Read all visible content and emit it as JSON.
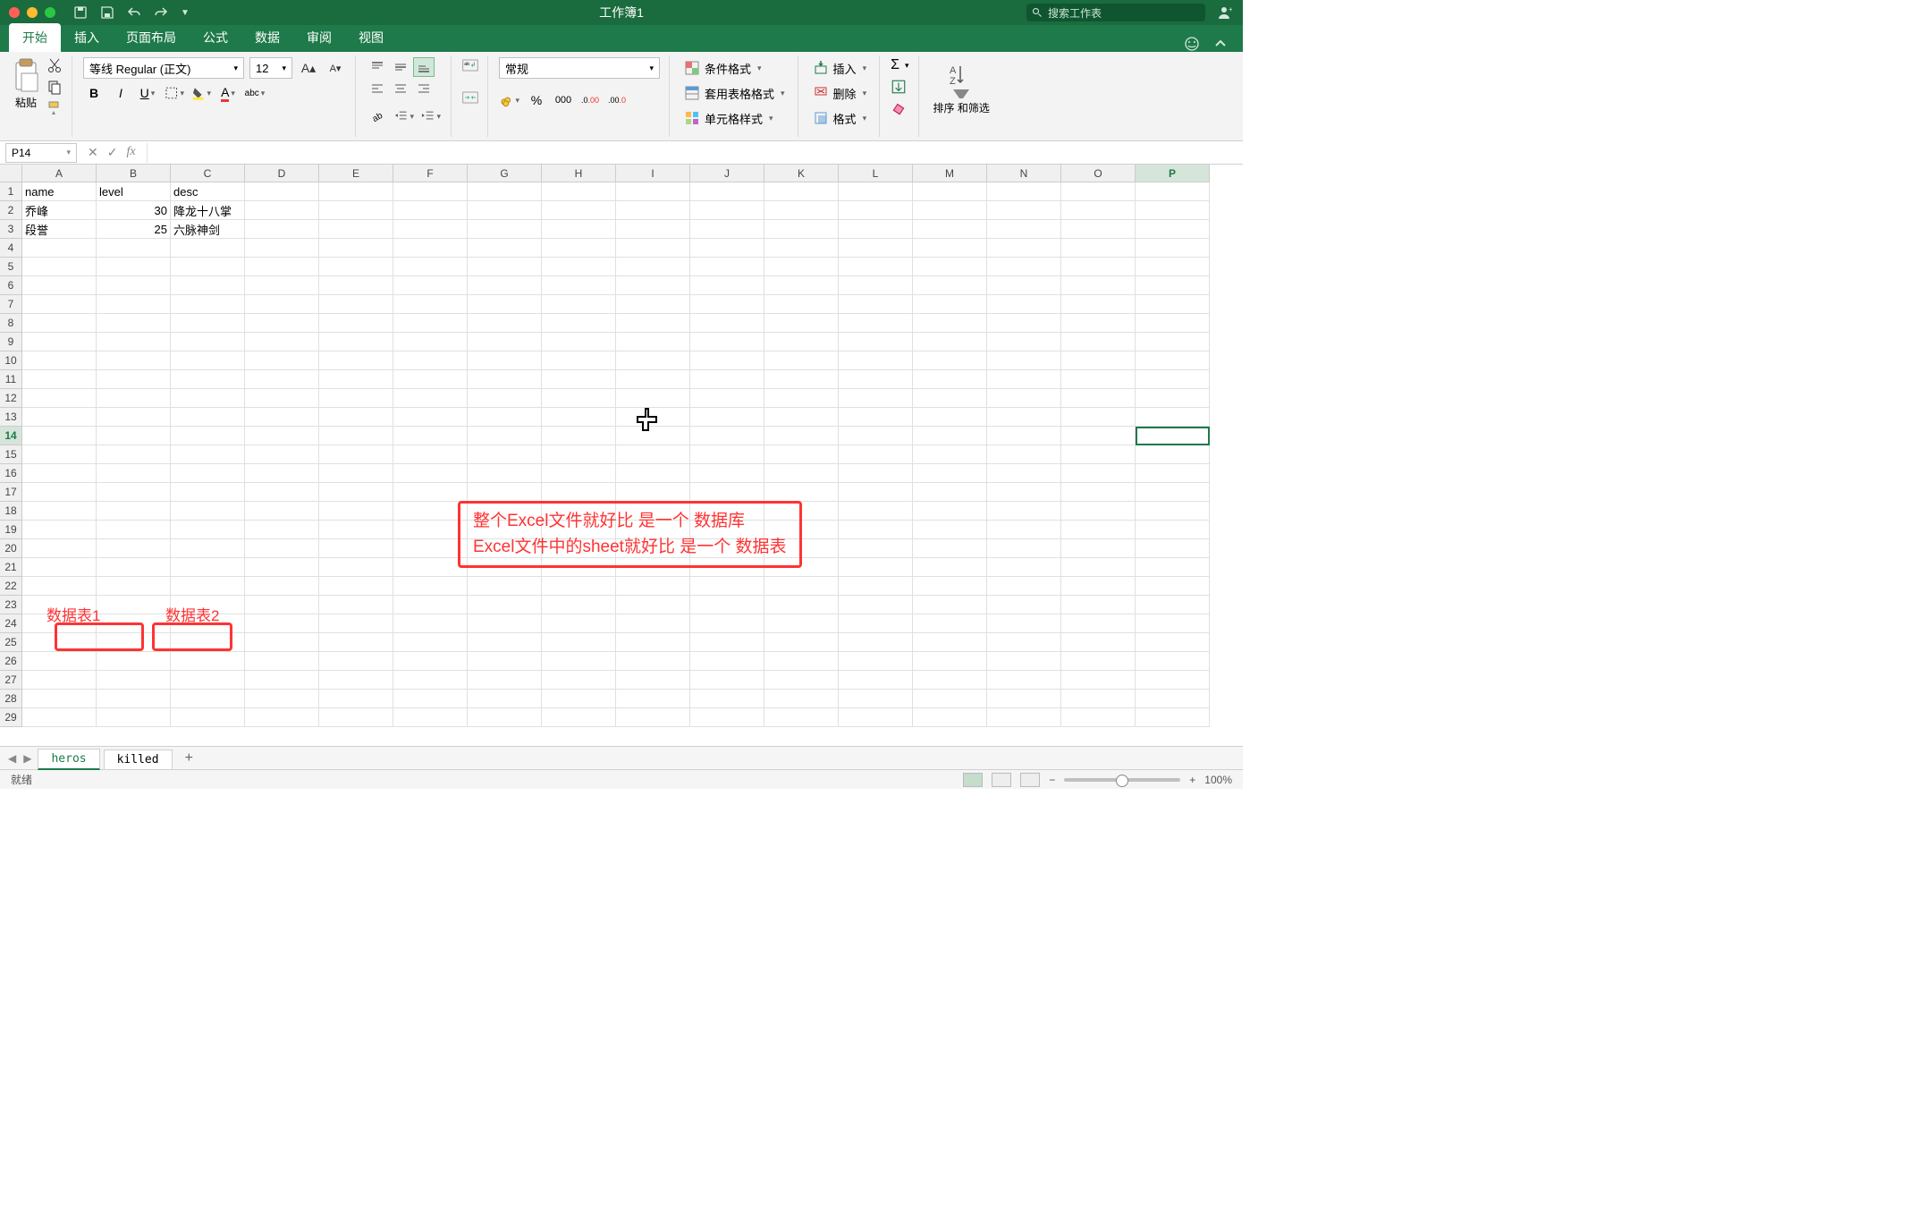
{
  "titlebar": {
    "title": "工作簿1",
    "search_placeholder": "搜索工作表"
  },
  "tabs": {
    "items": [
      "开始",
      "插入",
      "页面布局",
      "公式",
      "数据",
      "审阅",
      "视图"
    ],
    "active": 0
  },
  "ribbon": {
    "paste": "粘贴",
    "font_name": "等线 Regular (正文)",
    "font_size": "12",
    "number_format": "常规",
    "cond_fmt": "条件格式",
    "table_fmt": "套用表格格式",
    "cell_style": "单元格样式",
    "insert": "插入",
    "delete": "删除",
    "format": "格式",
    "sort_filter": "排序\n和筛选"
  },
  "formula_bar": {
    "cell_ref": "P14",
    "value": ""
  },
  "grid": {
    "columns": [
      "A",
      "B",
      "C",
      "D",
      "E",
      "F",
      "G",
      "H",
      "I",
      "J",
      "K",
      "L",
      "M",
      "N",
      "O",
      "P"
    ],
    "selected_col": "P",
    "rows": 29,
    "selected_row": 14,
    "data": [
      {
        "A": "name",
        "B": "level",
        "C": "desc"
      },
      {
        "A": "乔峰",
        "B": "30",
        "C": "降龙十八掌"
      },
      {
        "A": "段誉",
        "B": "25",
        "C": "六脉神剑"
      }
    ]
  },
  "annotation": {
    "line1": "整个Excel文件就好比 是一个 数据库",
    "line2": "Excel文件中的sheet就好比 是一个 数据表",
    "sheet1_label": "数据表1",
    "sheet2_label": "数据表2"
  },
  "sheets": {
    "tabs": [
      "heros",
      "killed"
    ],
    "active": 0
  },
  "status": {
    "ready": "就绪",
    "zoom": "100%"
  }
}
